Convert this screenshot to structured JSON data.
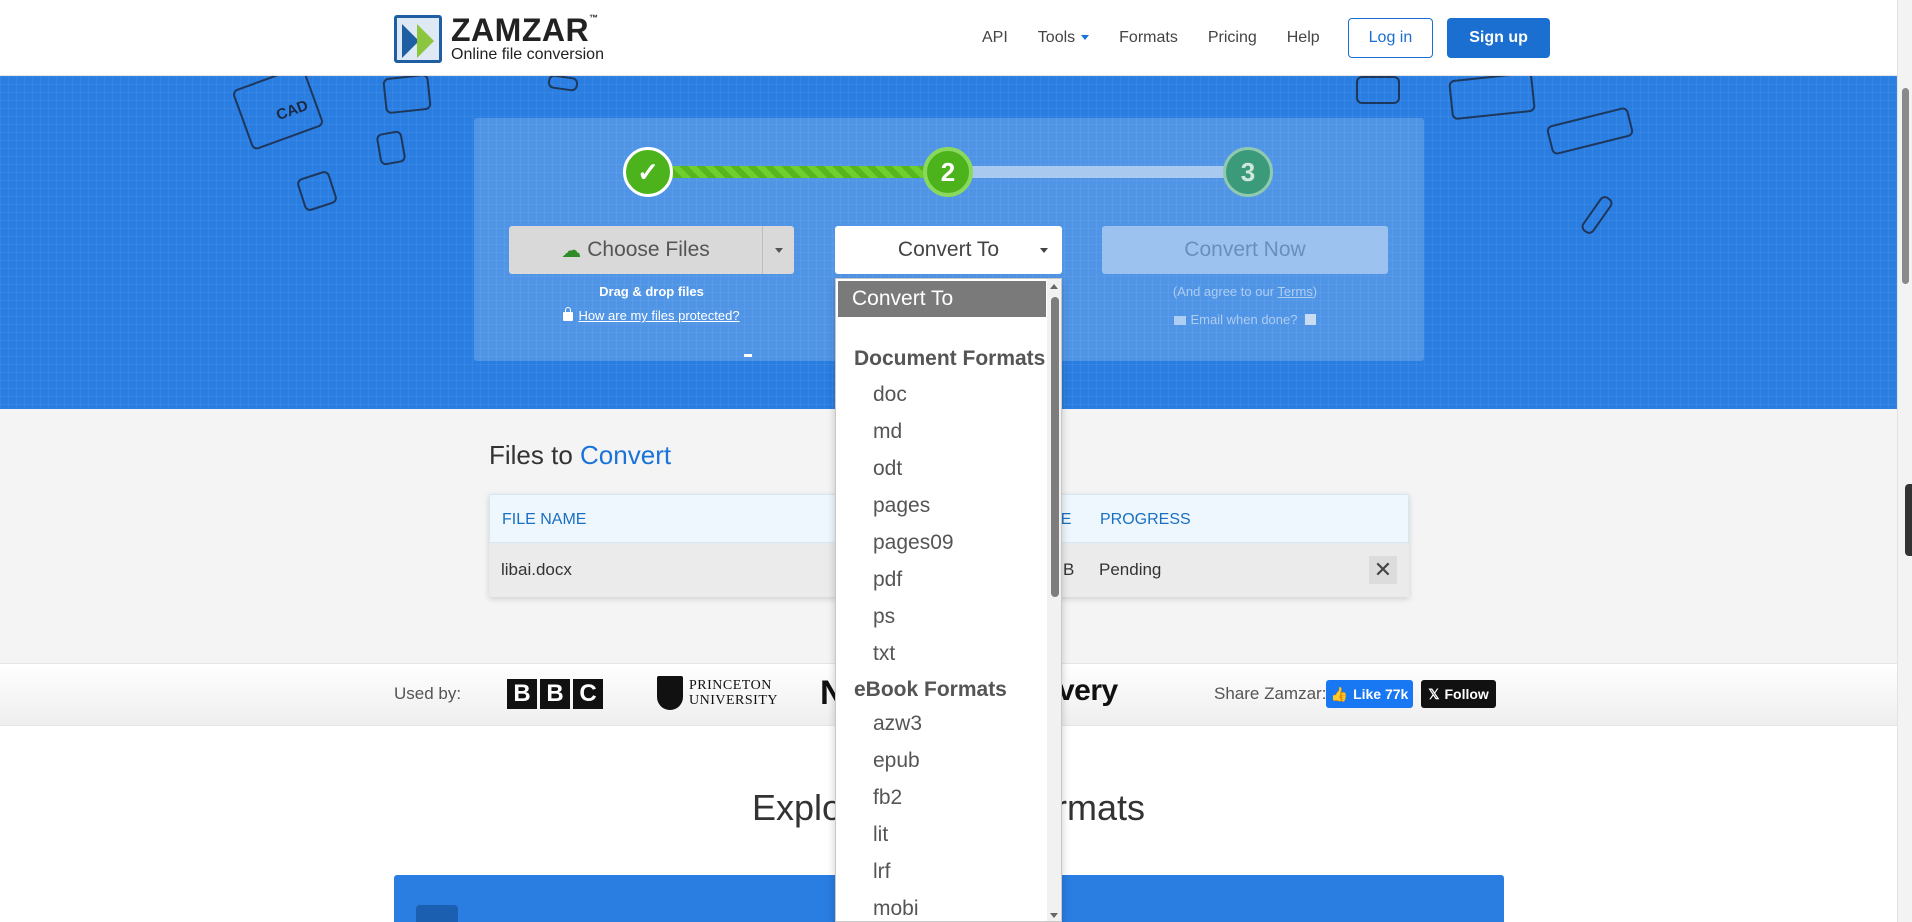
{
  "header": {
    "logo_name": "ZAMZAR",
    "logo_tm": "™",
    "logo_tagline": "Online file conversion",
    "nav": [
      "API",
      "Tools",
      "Formats",
      "Pricing",
      "Help"
    ],
    "login": "Log in",
    "signup": "Sign up"
  },
  "steps": {
    "step1": "✓",
    "step2": "2",
    "step3": "3"
  },
  "converter": {
    "choose_files": "Choose Files",
    "drag_drop": "Drag & drop files",
    "protect_link": "How are my files protected?",
    "convert_to": "Convert To",
    "convert_now": "Convert Now",
    "agree_prefix": "(And agree to our ",
    "agree_terms": "Terms",
    "agree_suffix": ")",
    "email_when_done": "Email when done?"
  },
  "files": {
    "title_prefix": "Files to ",
    "title_accent": "Convert",
    "col_file_name": "FILE NAME",
    "col_size_partial": "ZE",
    "col_progress": "PROGRESS",
    "row": {
      "file_name": "libai.docx",
      "size_partial": "B",
      "progress": "Pending",
      "remove": "✕"
    }
  },
  "used_by": {
    "label": "Used by:",
    "bbc": [
      "B",
      "B",
      "C"
    ],
    "princeton_1": "PRINCETON",
    "princeton_2": "UNIVERSITY",
    "partial_logo": "N",
    "partial_discovery": "very",
    "share_label": "Share Zamzar:",
    "fb_like": "Like 77k",
    "x_follow": "Follow"
  },
  "explore": {
    "title_left": "Explor",
    "title_right": "ormats"
  },
  "dropdown": {
    "selected": "Convert To",
    "group_document": "Document Formats",
    "document_items": [
      "doc",
      "md",
      "odt",
      "pages",
      "pages09",
      "pdf",
      "ps",
      "txt"
    ],
    "group_ebook": "eBook Formats",
    "ebook_items": [
      "azw3",
      "epub",
      "fb2",
      "lit",
      "lrf",
      "mobi"
    ]
  },
  "colors": {
    "brand_blue": "#1a6fd1",
    "hero_blue": "#2a7de1",
    "step_green": "#4db31d"
  }
}
